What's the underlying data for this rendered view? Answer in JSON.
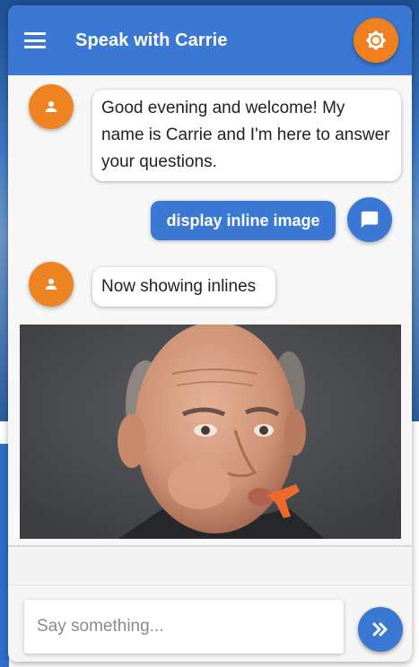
{
  "header": {
    "title": "Speak with Carrie",
    "menu_icon": "hamburger-menu-icon",
    "theme_icon": "brightness-icon"
  },
  "messages": [
    {
      "from": "bot",
      "avatar_icon": "person-icon",
      "text": "Good evening and welcome! My name is Carrie and I'm here to answer your questions."
    },
    {
      "from": "user",
      "avatar_icon": "chat-bubble-icon",
      "text": "display inline image"
    },
    {
      "from": "bot",
      "avatar_icon": "person-icon",
      "text": "Now showing inlines"
    },
    {
      "from": "bot",
      "type": "inline-image"
    }
  ],
  "input": {
    "value": "",
    "placeholder": "Say something..."
  },
  "send_icon": "double-chevron-right-icon",
  "colors": {
    "primary": "#3a78d4",
    "accent": "#f07f1e",
    "bubble_bg": "#ffffff",
    "chat_bg": "#f7f7f7"
  }
}
